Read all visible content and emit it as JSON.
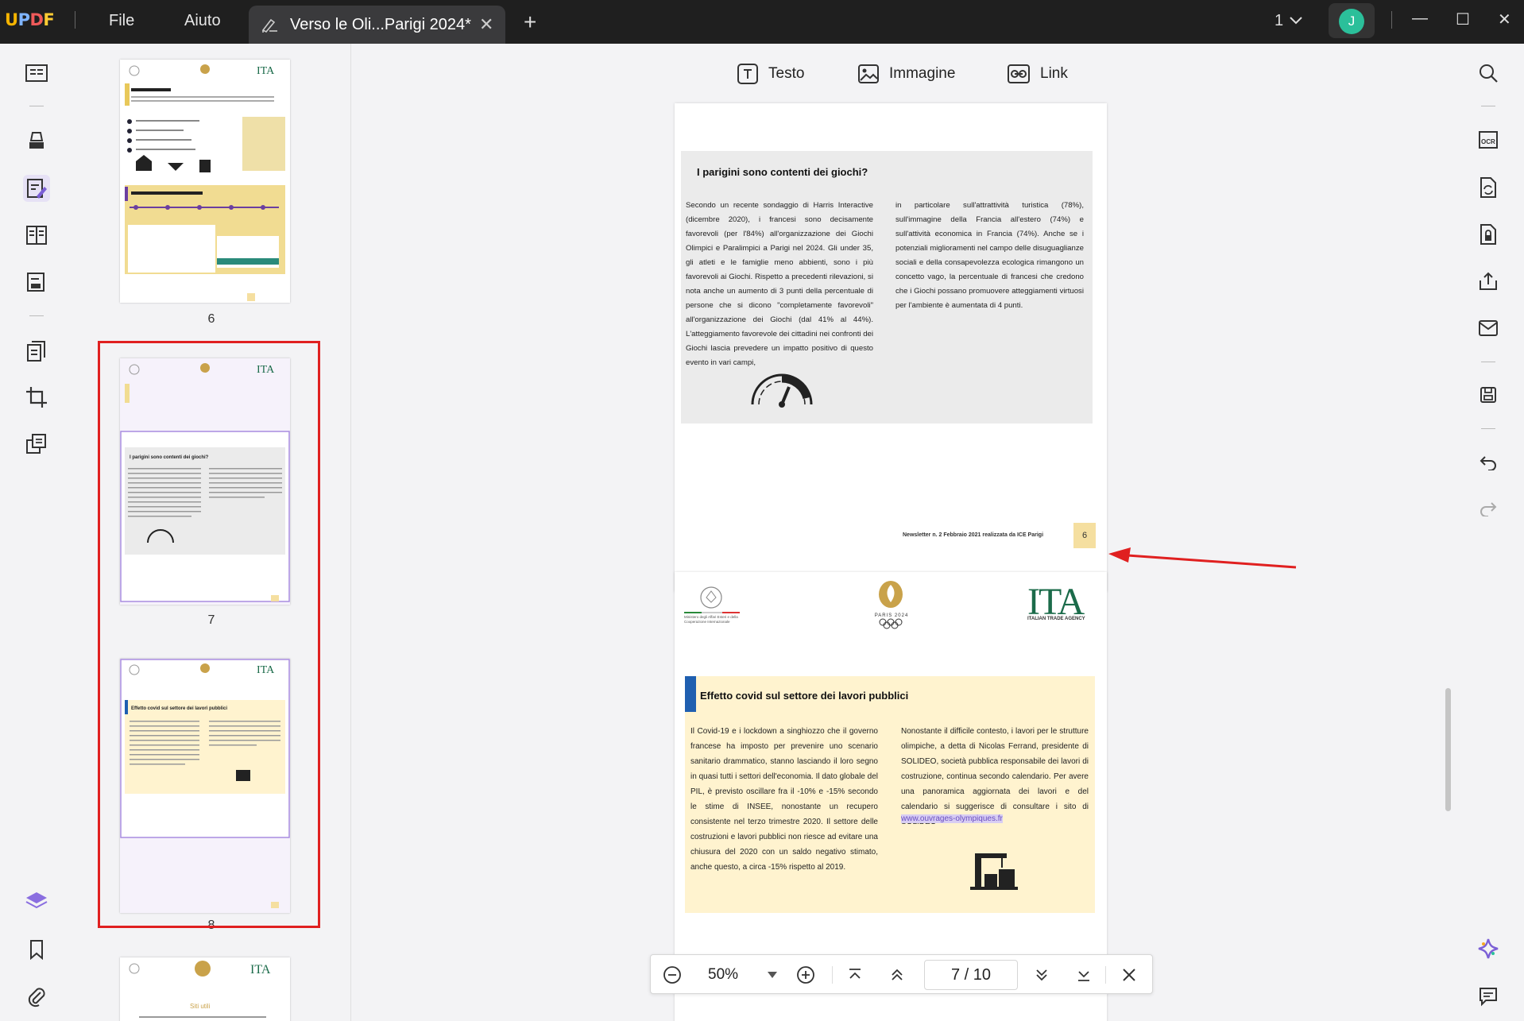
{
  "app": {
    "logo": {
      "u": "U",
      "p": "P",
      "d": "D",
      "f": "F"
    },
    "menu": {
      "file": "File",
      "help": "Aiuto"
    },
    "tab_title": "Verso le Oli...Parigi 2024*",
    "tab_close": "✕",
    "new_tab": "+",
    "window_count": "1",
    "avatar_initial": "J",
    "window_controls": {
      "minimize": "—",
      "maximize": "☐",
      "close": "✕"
    }
  },
  "toolbar": {
    "text": "Testo",
    "image": "Immagine",
    "link": "Link"
  },
  "thumbnails": {
    "pages": [
      "6",
      "7",
      "8"
    ],
    "p6_title": "Profili rilevanti",
    "p6_sub": "Procedura partecipazione gare d'appalto",
    "p7_title": "I parigini sono contenti dei giochi?",
    "p8_title": "Effetto covid sul settore dei lavori pubblici",
    "p9_title": "Siti utili"
  },
  "page6": {
    "title": "I parigini sono contenti dei giochi?",
    "col1": "Secondo un recente sondaggio di Harris Interactive (dicembre 2020), i francesi sono decisamente favorevoli (per l'84%) all'organizzazione dei Giochi Olimpici e Paralimpici a Parigi nel 2024. Gli under 35, gli atleti e le famiglie meno abbienti, sono i più favorevoli ai Giochi. Rispetto a precedenti rilevazioni, si nota anche un aumento di 3 punti della percentuale di persone che si dicono \"completamente favorevoli\" all'organizzazione dei Giochi (dal 41% al 44%). L'atteggiamento favorevole dei cittadini nei confronti dei Giochi lascia prevedere un impatto positivo di questo evento in vari campi,",
    "col2": "in particolare sull'attrattività turistica (78%), sull'immagine della Francia all'estero (74%) e sull'attività economica in Francia (74%). Anche se i potenziali miglioramenti nel campo delle disuguaglianze sociali e della consapevolezza ecologica rimangono un concetto vago, la percentuale di francesi che credono che i Giochi possano promuovere atteggiamenti virtuosi per l'ambiente è aumentata di 4 punti.",
    "footer": "Newsletter n. 2 Febbraio 2021 realizzata da ICE Parigi",
    "page_no": "6"
  },
  "page7": {
    "ministry": "Ministero degli Affari Esteri e della Cooperazione Internazionale",
    "paris_logo": "PARIS 2024",
    "ita_logo": "ITA",
    "ita_sub": "ITALIAN TRADE AGENCY",
    "title": "Effetto covid sul settore dei lavori pubblici",
    "col1": "Il Covid-19 e i lockdown a singhiozzo che il governo francese ha imposto per prevenire uno scenario sanitario drammatico, stanno lasciando il loro segno in quasi tutti i settori dell'economia. Il dato globale del PIL, è previsto oscillare fra il -10% e -15% secondo le stime di INSEE, nonostante un recupero consistente nel terzo trimestre 2020. Il settore delle costruzioni e lavori pubblici non riesce ad evitare una chiusura del 2020 con un saldo negativo stimato, anche questo, a circa -15% rispetto al 2019.",
    "col2": "Nonostante il difficile contesto, i lavori per le strutture olimpiche, a detta di Nicolas Ferrand, presidente di SOLIDEO, società pubblica responsabile dei lavori di costruzione, continua secondo calendario. Per avere una panoramica aggiornata dei lavori e del calendario si suggerisce di consultare i sito di SOLIDEO",
    "link": "www.ouvrages-olympiques.fr"
  },
  "zoombar": {
    "zoom": "50%",
    "current_page": "7",
    "total_pages": "10",
    "separator": "/"
  },
  "colors": {
    "accent": "#7b5fd6",
    "selection": "#e02020",
    "titlebar": "#1f1f1f"
  }
}
